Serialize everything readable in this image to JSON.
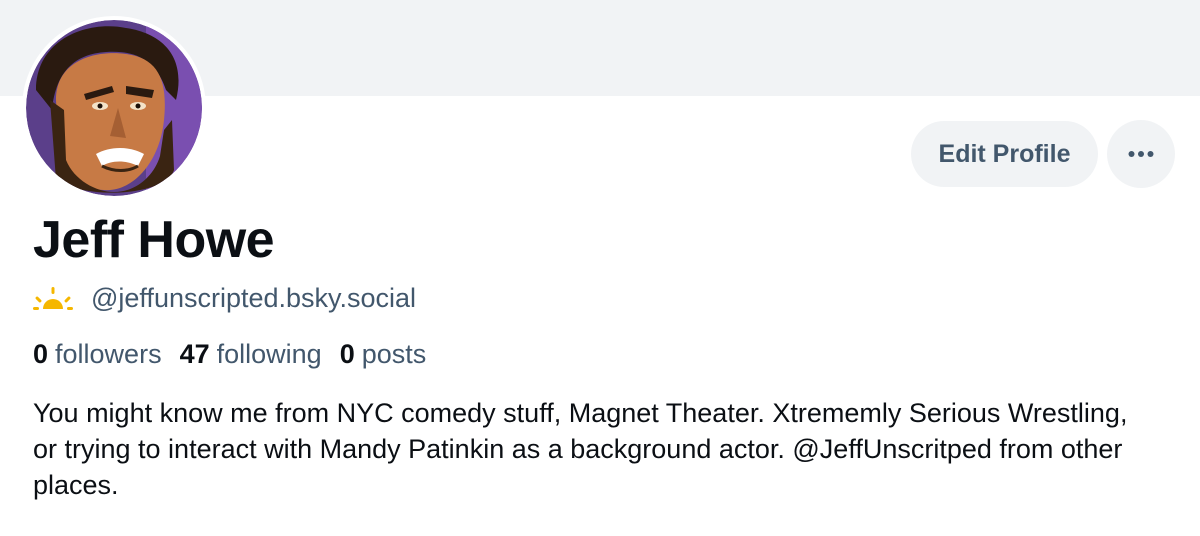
{
  "profile": {
    "display_name": "Jeff Howe",
    "handle": "@jeffunscripted.bsky.social",
    "handle_icon": "sun-icon",
    "bio": "You might know me from NYC comedy stuff, Magnet Theater. Xtrememly Serious Wrestling, or trying to interact with Mandy Patinkin as a background actor. @JeffUnscritped from other places."
  },
  "stats": {
    "followers_count": "0",
    "followers_label": "followers",
    "following_count": "47",
    "following_label": "following",
    "posts_count": "0",
    "posts_label": "posts"
  },
  "actions": {
    "edit_profile_label": "Edit Profile",
    "more_icon": "ellipsis-icon"
  },
  "colors": {
    "banner": "#f1f3f5",
    "button_bg": "#f1f3f5",
    "muted_text": "#42576c",
    "primary_text": "#0b0f14",
    "sun_icon": "#f5b700"
  }
}
